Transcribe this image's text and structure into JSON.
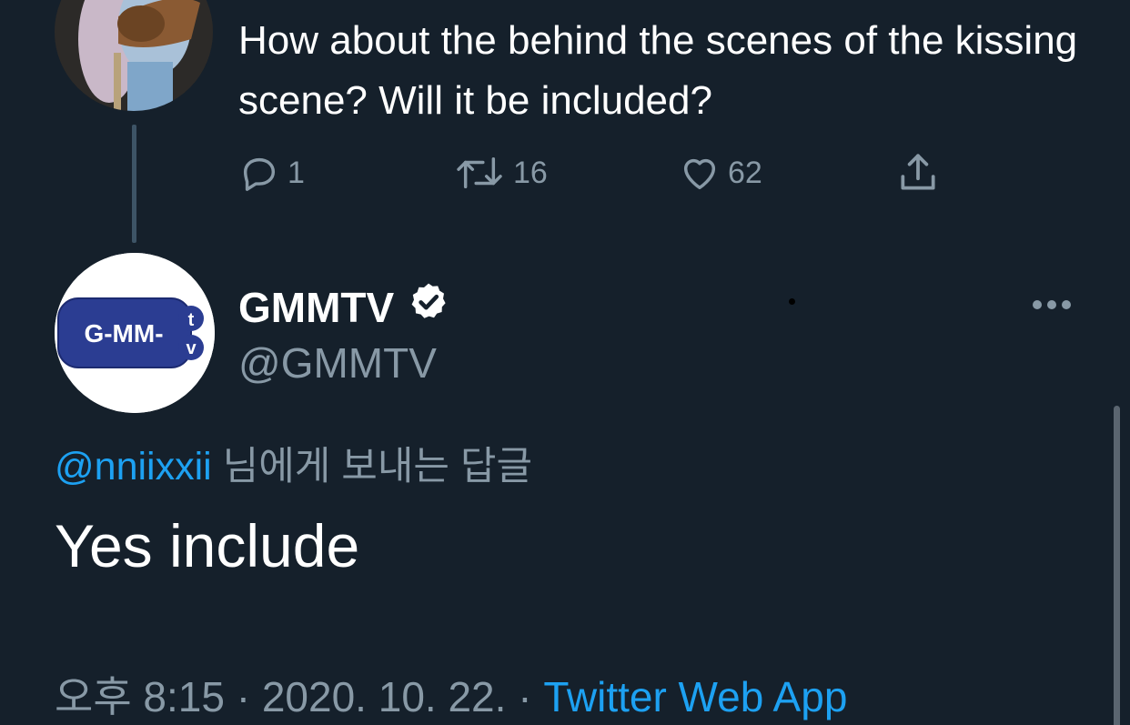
{
  "previous_tweet": {
    "text": "How about the behind the scenes of the kissing scene? Will it be included?",
    "replies": "1",
    "retweets": "16",
    "likes": "62"
  },
  "tweet": {
    "display_name": "GMMTV",
    "handle": "@GMMTV",
    "reply_prefix": "@nniixxii",
    "reply_suffix": " 님에게 보내는 답글",
    "text": "Yes include",
    "time": "오후 8:15",
    "separator": " · ",
    "date": "2020. 10. 22.",
    "source": "Twitter Web App",
    "avatar_logo_text": "G-MM-",
    "avatar_logo_badge": "tv"
  },
  "icons": {
    "reply": "reply-icon",
    "retweet": "retweet-icon",
    "like": "heart-icon",
    "share": "share-icon",
    "verified": "verified-badge-icon",
    "more": "more-options-icon"
  },
  "colors": {
    "background": "#15202b",
    "text_primary": "#ffffff",
    "text_secondary": "#8899a6",
    "accent": "#1da1f2"
  }
}
